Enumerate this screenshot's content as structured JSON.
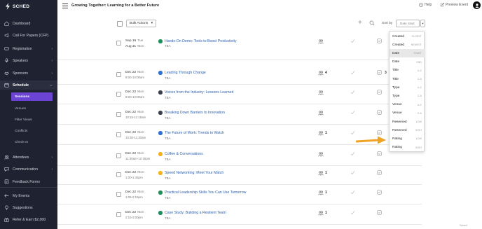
{
  "brand": {
    "name": "SCHED"
  },
  "header": {
    "event_title": "Growing Together: Learning for a Better Future",
    "help_label": "Help",
    "preview_label": "Preview Event"
  },
  "sidebar": {
    "items": [
      {
        "label": "Dashboard",
        "icon": "home-icon",
        "chevron": ""
      },
      {
        "label": "Call For Papers (CFP)",
        "icon": "megaphone-icon",
        "chevron": ""
      },
      {
        "label": "Registration",
        "icon": "ticket-icon",
        "chevron": "›"
      },
      {
        "label": "Speakers",
        "icon": "microphone-icon",
        "chevron": "›"
      },
      {
        "label": "Sponsors",
        "icon": "handshake-icon",
        "chevron": "›"
      },
      {
        "label": "Schedule",
        "icon": "calendar-icon",
        "chevron": "⌄"
      }
    ],
    "schedule_subitems": [
      "Sessions",
      "Venues",
      "Filter Views",
      "Conflicts",
      "Check-In"
    ],
    "items_after": [
      {
        "label": "Attendees",
        "icon": "people-icon",
        "chevron": "›"
      },
      {
        "label": "Communication",
        "icon": "chat-icon",
        "chevron": "›"
      },
      {
        "label": "Feedback Forms",
        "icon": "feedback-icon",
        "chevron": ""
      },
      {
        "label": "My Events",
        "icon": "arrow-left-icon",
        "chevron": ""
      },
      {
        "label": "Suggestions",
        "icon": "lightbulb-icon",
        "chevron": ""
      },
      {
        "label": "Refer & Earn $2,000",
        "icon": "gift-icon",
        "chevron": ""
      }
    ]
  },
  "toolbar": {
    "bulk_actions_label": "Bulk Actions",
    "sort_by_label": "Sort by",
    "sort_value": "Date Start"
  },
  "sessions": [
    {
      "date": "Sep 16",
      "dow": "Tue",
      "date2": "Aug 31",
      "dow2": "Mon",
      "time": "",
      "title": "Hands-On Demo: Tools to Boost Productivity",
      "venue": "TBA",
      "color": "#1e8f5a",
      "attendees": "",
      "rating": ""
    },
    {
      "date": "Dec 22",
      "dow": "Mon",
      "time": "9:00-10:00am",
      "title": "Leading Through Change",
      "venue": "TBA",
      "color": "#2f6fd6",
      "attendees": "4",
      "rating": "3"
    },
    {
      "date": "Dec 22",
      "dow": "Mon",
      "time": "9:00-10:00am",
      "title": "Voices from the Industry: Lessons Learned",
      "venue": "TBA",
      "color": "#3a3f4b",
      "attendees": "",
      "rating": ""
    },
    {
      "date": "Dec 22",
      "dow": "Mon",
      "time": "10:15-11:15am",
      "title": "Breaking Down Barriers to Innovation",
      "venue": "TBA",
      "color": "#3a3f4b",
      "attendees": "",
      "rating": ""
    },
    {
      "date": "Dec 22",
      "dow": "Mon",
      "time": "10:30-11:30am",
      "title": "The Future of Work: Trends to Watch",
      "venue": "TBA",
      "color": "#2f6fd6",
      "attendees": "1",
      "rating": ""
    },
    {
      "date": "Dec 22",
      "dow": "Mon",
      "time": "11:30am-12:15pm",
      "title": "Coffee & Conversations",
      "venue": "TBA",
      "color": "#f2b21b",
      "attendees": "",
      "rating": ""
    },
    {
      "date": "Dec 22",
      "dow": "Mon",
      "time": "1:00-1:45pm",
      "title": "Speed Networking: Meet Your Match",
      "venue": "TBA",
      "color": "#f2b21b",
      "attendees": "1",
      "rating": ""
    },
    {
      "date": "Dec 22",
      "dow": "Mon",
      "time": "1:05-2:15pm",
      "title": "Practical Leadership Skills You Can Use Tomorrow",
      "venue": "TBA",
      "color": "#1e8f5a",
      "attendees": "1",
      "rating": ""
    },
    {
      "date": "Dec 22",
      "dow": "Mon",
      "time": "2:15-3:00pm",
      "title": "Case Study: Building a Resilient Team",
      "venue": "TBA",
      "color": "#1e8f5a",
      "attendees": "1",
      "rating": ""
    }
  ],
  "sort_menu": {
    "options": [
      {
        "label": "Created",
        "dir": "OLDEST",
        "selected": false
      },
      {
        "label": "Created",
        "dir": "NEWEST",
        "selected": false
      },
      {
        "label": "Date",
        "dir": "START",
        "selected": true
      },
      {
        "label": "Date",
        "dir": "END",
        "selected": false
      },
      {
        "label": "Title",
        "dir": "A-Z",
        "selected": false
      },
      {
        "label": "Title",
        "dir": "Z-A",
        "selected": false
      },
      {
        "label": "Type",
        "dir": "A-Z",
        "selected": false
      },
      {
        "label": "Type",
        "dir": "Z-A",
        "selected": false
      },
      {
        "label": "Venue",
        "dir": "A-Z",
        "selected": false
      },
      {
        "label": "Venue",
        "dir": "Z-A",
        "selected": false
      },
      {
        "label": "Reserved",
        "dir": "LOW",
        "selected": false
      },
      {
        "label": "Reserved",
        "dir": "HIGH",
        "selected": false
      },
      {
        "label": "Rating",
        "dir": "LOW",
        "selected": false
      },
      {
        "label": "Rating",
        "dir": "HIGH",
        "selected": false
      }
    ]
  },
  "footer": {
    "brand": "Sched"
  },
  "colors": {
    "sidebar_bg": "#1f2331",
    "accent": "#6b44d4",
    "link": "#2b5fae",
    "arrow": "#f0a426"
  }
}
